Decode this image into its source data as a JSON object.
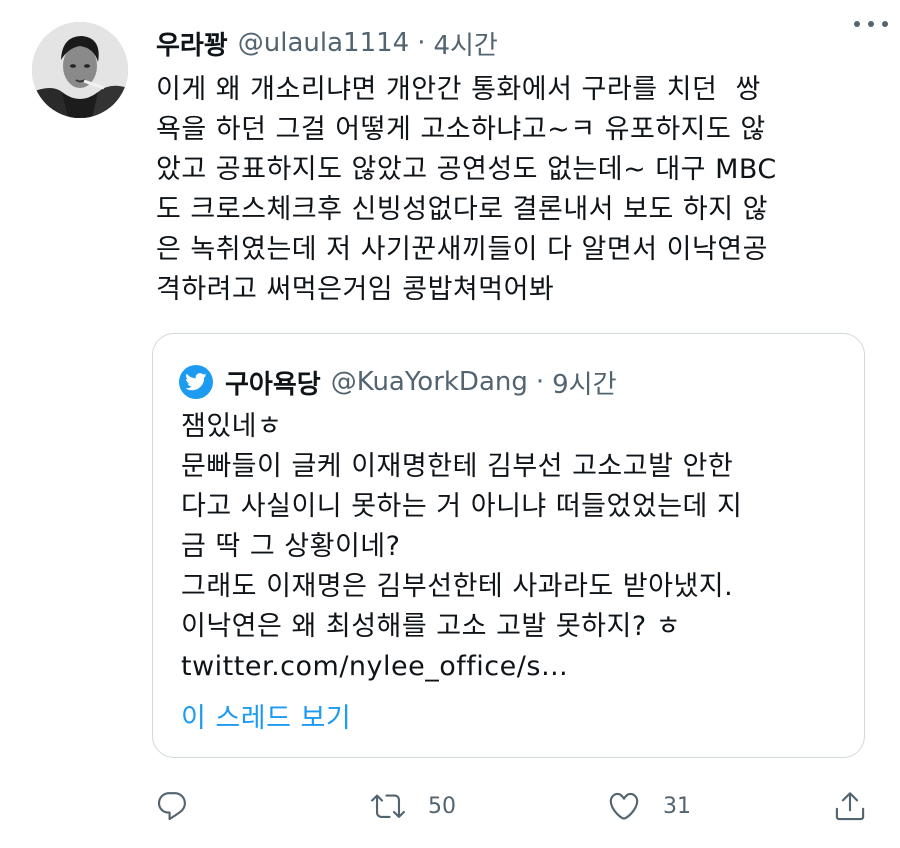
{
  "tweet": {
    "display_name": "우라꽝",
    "handle": "@ulaula1114",
    "separator": "·",
    "time": "4시간",
    "text": "이게 왜 개소리냐면 개안간 통화에서 구라를 치던  쌍\n욕을 하던 그걸 어떻게 고소하냐고~ㅋ 유포하지도 않\n았고 공표하지도 않았고 공연성도 없는데~ 대구 MBC\n도 크로스체크후 신빙성없다로 결론내서 보도 하지 않\n은 녹취였는데 저 사기꾼새끼들이 다 알면서 이낙연공\n격하려고 써먹은거임 콩밥쳐먹어봐"
  },
  "quote": {
    "display_name": "구아욕당",
    "handle": "@KuaYorkDang",
    "separator": "·",
    "time": "9시간",
    "text": "잼있네ㅎ\n문빠들이 글케 이재명한테 김부선 고소고발 안한\n다고 사실이니 못하는 거 아니냐 떠들었었는데 지\n금 딱 그 상황이네?\n그래도 이재명은 김부선한테 사과라도 받아냈지.\n이낙연은 왜 최성해를 고소 고발 못하지? ㅎ",
    "link": "twitter.com/nylee_office/s…",
    "thread_label": "이 스레드 보기"
  },
  "actions": {
    "retweets": "50",
    "likes": "31"
  },
  "icons": {
    "more": "more-horizontal-icon",
    "reply": "reply-icon",
    "retweet": "retweet-icon",
    "like": "heart-icon",
    "share": "share-icon",
    "quote_badge": "twitter-bird-icon"
  },
  "colors": {
    "accent": "#1d9bf0",
    "secondary_text": "#536471",
    "border": "#cfd9de"
  }
}
